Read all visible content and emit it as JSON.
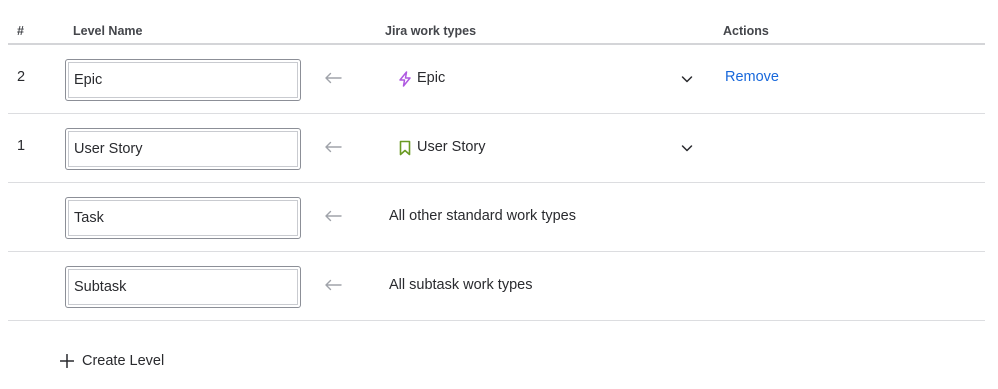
{
  "table": {
    "headers": {
      "number": "#",
      "level_name": "Level Name",
      "jira_work_types": "Jira work types",
      "actions": "Actions"
    },
    "rows": [
      {
        "number": "2",
        "level_name": "Epic",
        "work_type": "Epic",
        "work_type_icon": "lightning-bolt-icon",
        "icon_color": "#af59e1",
        "action": "Remove"
      },
      {
        "number": "1",
        "level_name": "User Story",
        "work_type": "User Story",
        "work_type_icon": "bookmark-icon",
        "icon_color": "#6a9a23"
      },
      {
        "number": "",
        "level_name": "Task",
        "work_type": "All other standard work types"
      },
      {
        "number": "",
        "level_name": "Subtask",
        "work_type": "All subtask work types"
      }
    ]
  },
  "footer": {
    "create_label": "Create Level"
  },
  "colors": {
    "link": "#1868db",
    "arrow": "#a0a3aa",
    "divider": "#dcdde0"
  }
}
